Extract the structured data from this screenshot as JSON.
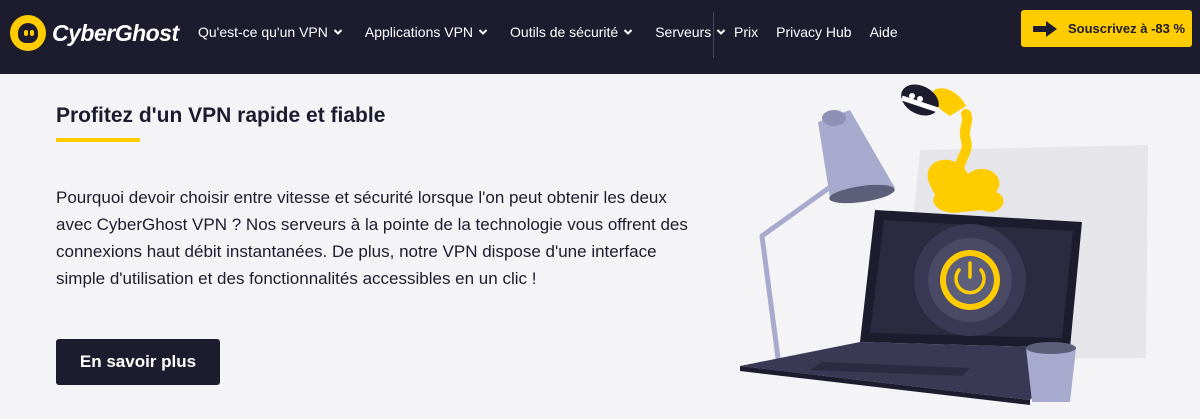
{
  "brand": {
    "name": "CyberGhost",
    "accent_color": "#ffcc00",
    "dark_color": "#1d1b2e"
  },
  "nav": {
    "menu": [
      {
        "label": "Qu'est-ce qu'un VPN",
        "icon": "chevron-down-icon"
      },
      {
        "label": "Applications VPN",
        "icon": "chevron-down-icon"
      },
      {
        "label": "Outils de sécurité",
        "icon": "chevron-down-icon"
      },
      {
        "label": "Serveurs",
        "icon": "chevron-down-icon"
      }
    ],
    "links": [
      "Prix",
      "Privacy Hub",
      "Aide"
    ],
    "cta_label": "Souscrivez à -83 %",
    "cta_icon": "arrow-right-icon"
  },
  "hero": {
    "heading": "Profitez d'un VPN rapide et fiable",
    "body": "Pourquoi devoir choisir entre vitesse et sécurité lorsque l'on peut obtenir les deux avec CyberGhost VPN ? Nos serveurs à la pointe de la technologie vous offrent des connexions haut débit instantanées. De plus, notre VPN dispose d'une interface simple d'utilisation et des fonctionnalités accessibles en un clic !",
    "button_label": "En savoir plus"
  }
}
